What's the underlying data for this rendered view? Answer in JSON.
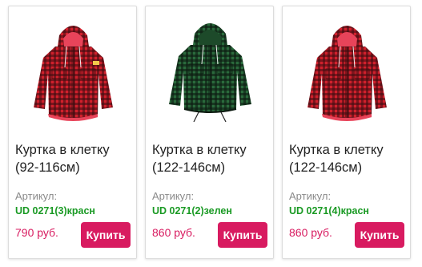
{
  "colors": {
    "accent": "#d81b60",
    "sku_green": "#1a9a24",
    "muted": "#8a8a8a"
  },
  "products": [
    {
      "title_line1": "Куртка в клетку",
      "title_line2": "(92-116см)",
      "sku_label": "Артикул:",
      "sku": "UD 0271(3)красн",
      "price": "790 руб.",
      "buy_label": "Купить",
      "image": "red-black-plaid-hooded-jacket"
    },
    {
      "title_line1": "Куртка в клетку",
      "title_line2": "(122-146см)",
      "sku_label": "Артикул:",
      "sku": "UD 0271(2)зелен",
      "price": "860 руб.",
      "buy_label": "Купить",
      "image": "green-black-plaid-hooded-jacket"
    },
    {
      "title_line1": "Куртка в клетку",
      "title_line2": "(122-146см)",
      "sku_label": "Артикул:",
      "sku": "UD 0271(4)красн",
      "price": "860 руб.",
      "buy_label": "Купить",
      "image": "red-black-plaid-hooded-jacket"
    }
  ]
}
